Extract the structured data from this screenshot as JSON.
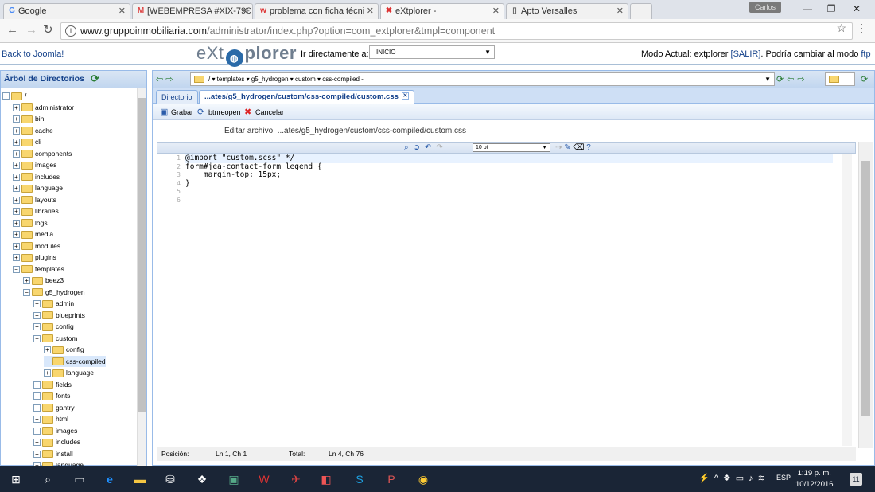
{
  "browser": {
    "tabs": [
      {
        "title": "Google",
        "icon": "google-icon"
      },
      {
        "title": "[WEBEMPRESA #XIX-79€",
        "icon": "gmail-icon"
      },
      {
        "title": "problema con ficha técni",
        "icon": "webempresa-icon"
      },
      {
        "title": "eXtplorer -",
        "icon": "extplorer-icon"
      },
      {
        "title": "Apto Versalles",
        "icon": "page-icon"
      }
    ],
    "user": "Carlos",
    "url_host": "www.gruppoinmobiliaria.com",
    "url_path": "/administrator/index.php?option=com_extplorer&tmpl=component"
  },
  "header": {
    "back_link": "Back to Joomla!",
    "logo_pre": "eXt",
    "logo_post": "plorer",
    "goto_label": "Ir directamente a:",
    "goto_value": "INICIO",
    "mode_prefix": "Modo Actual: extplorer ",
    "mode_exit": "[SALIR]",
    "mode_mid": ". Podría cambiar al modo ",
    "mode_ftp": "ftp"
  },
  "tree": {
    "title": "Árbol de Directorios",
    "root": "/",
    "nodes": [
      {
        "label": "administrator",
        "depth": 1,
        "open": false
      },
      {
        "label": "bin",
        "depth": 1,
        "open": false
      },
      {
        "label": "cache",
        "depth": 1,
        "open": false
      },
      {
        "label": "cli",
        "depth": 1,
        "open": false
      },
      {
        "label": "components",
        "depth": 1,
        "open": false
      },
      {
        "label": "images",
        "depth": 1,
        "open": false
      },
      {
        "label": "includes",
        "depth": 1,
        "open": false
      },
      {
        "label": "language",
        "depth": 1,
        "open": false
      },
      {
        "label": "layouts",
        "depth": 1,
        "open": false
      },
      {
        "label": "libraries",
        "depth": 1,
        "open": false
      },
      {
        "label": "logs",
        "depth": 1,
        "open": false
      },
      {
        "label": "media",
        "depth": 1,
        "open": false
      },
      {
        "label": "modules",
        "depth": 1,
        "open": false
      },
      {
        "label": "plugins",
        "depth": 1,
        "open": false
      },
      {
        "label": "templates",
        "depth": 1,
        "open": true
      },
      {
        "label": "beez3",
        "depth": 2,
        "open": false
      },
      {
        "label": "g5_hydrogen",
        "depth": 2,
        "open": true
      },
      {
        "label": "admin",
        "depth": 3,
        "open": false
      },
      {
        "label": "blueprints",
        "depth": 3,
        "open": false
      },
      {
        "label": "config",
        "depth": 3,
        "open": false
      },
      {
        "label": "custom",
        "depth": 3,
        "open": true
      },
      {
        "label": "config",
        "depth": 4,
        "open": false
      },
      {
        "label": "css-compiled",
        "depth": 4,
        "open": null,
        "selected": true
      },
      {
        "label": "language",
        "depth": 4,
        "open": false
      },
      {
        "label": "fields",
        "depth": 3,
        "open": false
      },
      {
        "label": "fonts",
        "depth": 3,
        "open": false
      },
      {
        "label": "gantry",
        "depth": 3,
        "open": false
      },
      {
        "label": "html",
        "depth": 3,
        "open": false
      },
      {
        "label": "images",
        "depth": 3,
        "open": false
      },
      {
        "label": "includes",
        "depth": 3,
        "open": false
      },
      {
        "label": "install",
        "depth": 3,
        "open": false
      },
      {
        "label": "language",
        "depth": 3,
        "open": false
      }
    ]
  },
  "pathbar": {
    "crumbs": "/ ▾  templates ▾  g5_hydrogen ▾  custom ▾  css-compiled -"
  },
  "tabs": {
    "dir_tab": "Directorio",
    "file_tab": "...ates/g5_hydrogen/custom/css-compiled/custom.css"
  },
  "editor": {
    "save": "Grabar",
    "reopen": "btnreopen",
    "cancel": "Cancelar",
    "file_label": "Editar archivo: ...ates/g5_hydrogen/custom/css-compiled/custom.css",
    "font_size": "10 pt",
    "line_numbers": [
      "1",
      "2",
      "3",
      "4",
      "5",
      "6"
    ],
    "code_lines": [
      "@import \"custom.scss\" */",
      "form#jea-contact-form legend {",
      "    margin-top: 15px;",
      "}",
      "",
      ""
    ],
    "status": {
      "pos_label": "Posición:",
      "pos_value": "Ln 1, Ch 1",
      "total_label": "Total:",
      "total_value": "Ln 4, Ch 76"
    }
  },
  "taskbar": {
    "lang": "ESP",
    "time": "1:19 p. m.",
    "date": "10/12/2016",
    "notifications": "11"
  }
}
